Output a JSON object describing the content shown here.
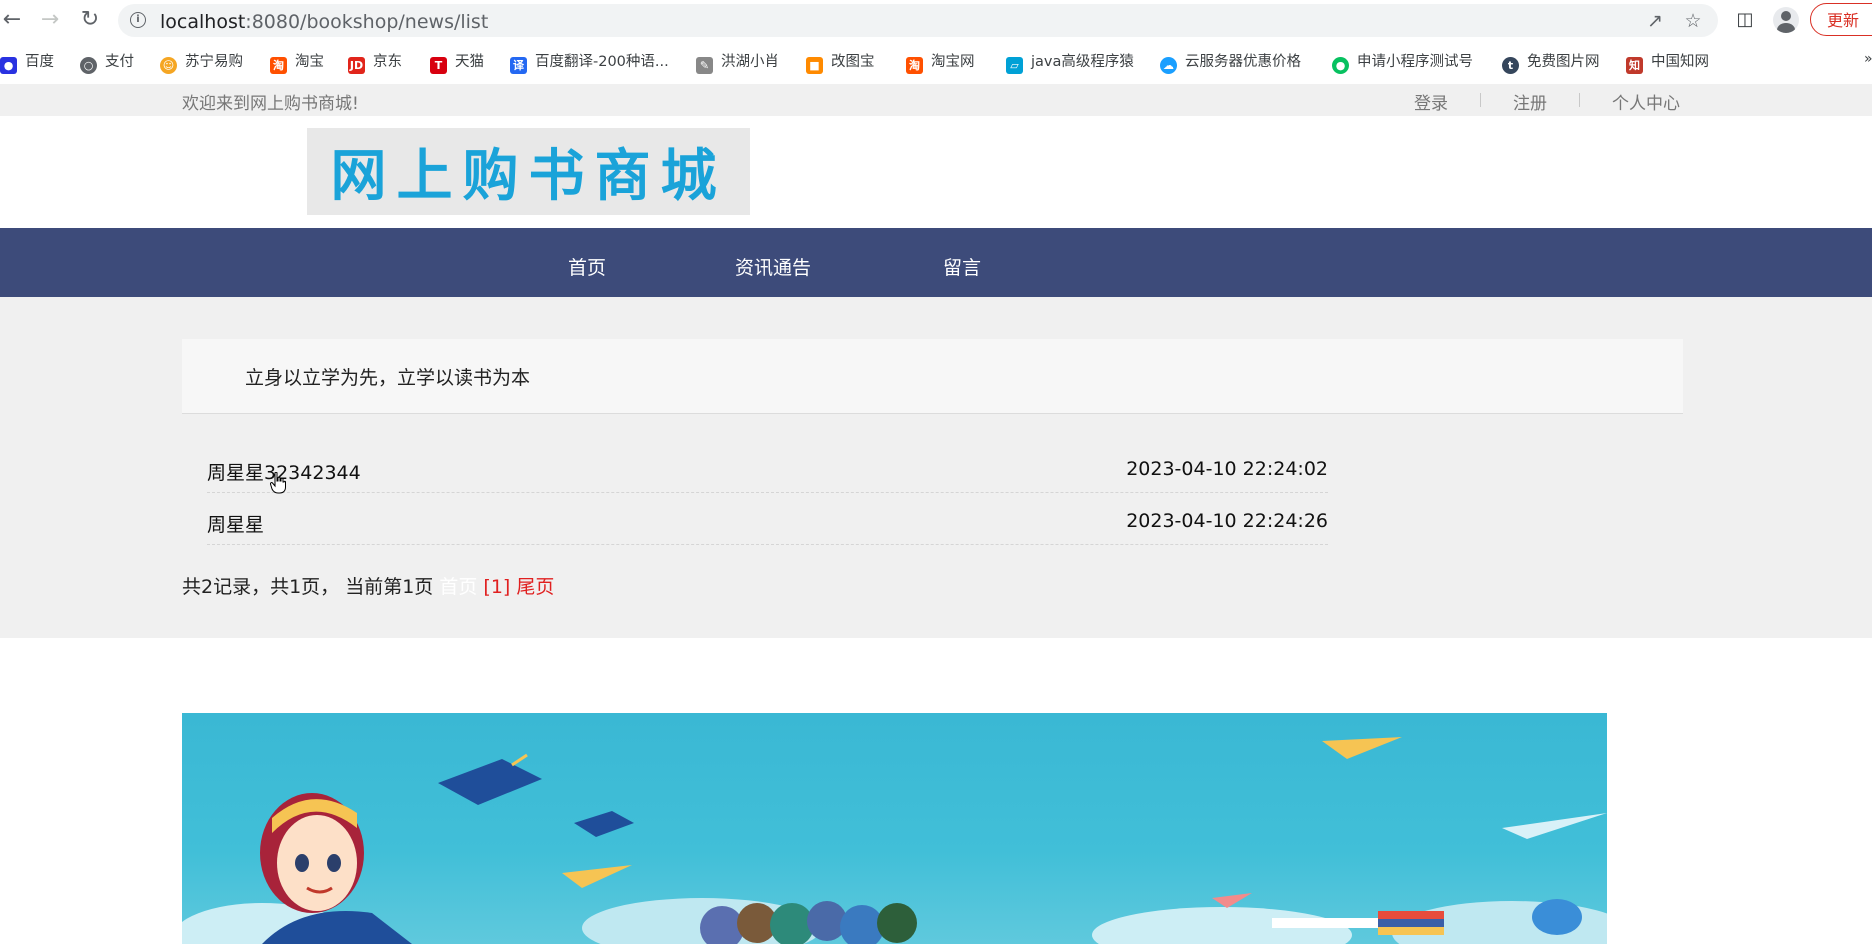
{
  "browser": {
    "url_host": "localhost",
    "url_path": ":8080/bookshop/news/list",
    "update_label": "更新"
  },
  "bookmarks": [
    {
      "label": "百度",
      "icon": "baidu-paw-icon",
      "color": "#2932e1"
    },
    {
      "label": "支付",
      "icon": "globe-icon",
      "color": "#5f6368"
    },
    {
      "label": "苏宁易购",
      "icon": "suning-icon",
      "color": "#f5a623"
    },
    {
      "label": "淘宝",
      "icon": "taobao-icon",
      "color": "#ff5000"
    },
    {
      "label": "京东",
      "icon": "jd-icon",
      "color": "#e1251b"
    },
    {
      "label": "天猫",
      "icon": "tmall-icon",
      "color": "#d8000f"
    },
    {
      "label": "百度翻译-200种语...",
      "icon": "translate-icon",
      "color": "#2468f2"
    },
    {
      "label": "洪湖小肖",
      "icon": "bookmark-icon",
      "color": "#888888"
    },
    {
      "label": "改图宝",
      "icon": "gaitubao-icon",
      "color": "#ff8a00"
    },
    {
      "label": "淘宝网",
      "icon": "taobao-icon",
      "color": "#ff5000"
    },
    {
      "label": "java高级程序猿",
      "icon": "bilibili-icon",
      "color": "#00a1d6"
    },
    {
      "label": "云服务器优惠价格",
      "icon": "cloud-icon",
      "color": "#1a9fff"
    },
    {
      "label": "申请小程序测试号",
      "icon": "wechat-icon",
      "color": "#07c160"
    },
    {
      "label": "免费图片网",
      "icon": "tumblr-icon",
      "color": "#35465c"
    },
    {
      "label": "中国知网",
      "icon": "cnki-icon",
      "color": "#c0392b"
    }
  ],
  "topbar": {
    "welcome": "欢迎来到网上购书商城!",
    "login": "登录",
    "register": "注册",
    "profile": "个人中心"
  },
  "logo": {
    "text": "网上购书商城"
  },
  "nav": {
    "home": "首页",
    "news": "资讯通告",
    "message": "留言"
  },
  "motto": "立身以立学为先，立学以读书为本",
  "news": [
    {
      "title": "周星星32342344",
      "date": "2023-04-10 22:24:02"
    },
    {
      "title": "周星星",
      "date": "2023-04-10 22:24:26"
    }
  ],
  "pager": {
    "summary": "共2记录，共1页， 当前第1页",
    "first": "首页",
    "current": "[1]",
    "last": "尾页"
  },
  "colors": {
    "nav_bg": "#3d4b7a",
    "logo_text": "#1aa3d9",
    "pager_link": "#e02020",
    "banner_bg": "#41bfd8"
  }
}
